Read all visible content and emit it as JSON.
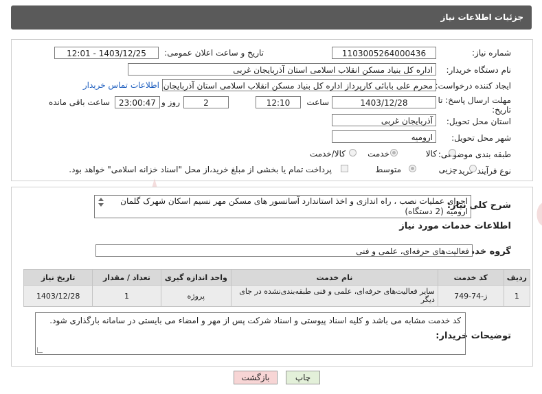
{
  "header": {
    "title": "جزئیات اطلاعات نیاز"
  },
  "form": {
    "need_number_label": "شماره نیاز:",
    "need_number": "1103005264000436",
    "announce_label": "تاریخ و ساعت اعلان عمومی:",
    "announce_value": "1403/12/25 - 12:01",
    "buyer_label": "نام دستگاه خریدار:",
    "buyer_value": "اداره کل بنیاد مسکن انقلاب اسلامی استان آذربایجان غربی",
    "creator_label": "ایجاد کننده درخواست:",
    "creator_value": "محرم علی بابائی کارپرداز اداره کل بنیاد مسکن انقلاب اسلامی استان آذربایجان",
    "contact_link": "اطلاعات تماس خریدار",
    "deadline_label_1": "مهلت ارسال پاسخ: تا",
    "deadline_label_2": "تاریخ:",
    "deadline_date": "1403/12/28",
    "time_label": "ساعت",
    "deadline_time": "12:10",
    "days_value": "2",
    "days_label": "روز و",
    "remaining_time": "23:00:47",
    "remaining_label": "ساعت باقی مانده",
    "province_label": "استان محل تحویل:",
    "province_value": "آذربایجان غربی",
    "city_label": "شهر محل تحویل:",
    "city_value": "ارومیه",
    "category_label": "طبقه بندی موضوعی:",
    "category_options": [
      "کالا",
      "خدمت",
      "کالا/خدمت"
    ],
    "process_label": "نوع فرآیند خرید :",
    "process_options": [
      "جزیی",
      "متوسط"
    ],
    "payment_text": "پرداخت تمام یا بخشی از مبلغ خرید،از محل \"اسناد خزانه اسلامی\" خواهد بود."
  },
  "summary": {
    "label": "شرح کلی نیاز:",
    "text": "اجرای عملیات نصب ، راه اندازی و اخذ استاندارد آسانسور های مسکن مهر نسیم اسکان شهرک گلمان ارومیه (2 دستگاه)",
    "services_heading": "اطلاعات خدمات مورد نیاز",
    "group_label": "گروه خدمت:",
    "group_value": "فعالیت‌های حرفه‌ای، علمی و فنی"
  },
  "table": {
    "headers": [
      "ردیف",
      "کد خدمت",
      "نام خدمت",
      "واحد اندازه گیری",
      "تعداد / مقدار",
      "تاریخ نیاز"
    ],
    "rows": [
      [
        "1",
        "ز-74-749",
        "سایر فعالیت‌های حرفه‌ای، علمی و فنی طبقه‌بندی‌نشده در جای دیگر",
        "پروژه",
        "1",
        "1403/12/28"
      ]
    ]
  },
  "notes": {
    "label": "توضیحات خریدار:",
    "text": "کد خدمت مشابه می باشد و کلیه اسناد پیوستی و اسناد شرکت پس از مهر و امضاء می بایستی در سامانه بارگذاری شود."
  },
  "buttons": {
    "print": "چاپ",
    "back": "بازگشت"
  },
  "colors": {
    "header_bg": "#5a5a5a",
    "link": "#1f5fbf",
    "back_btn_bg": "#f7d5d5",
    "print_btn_bg": "#e3f0d9"
  }
}
